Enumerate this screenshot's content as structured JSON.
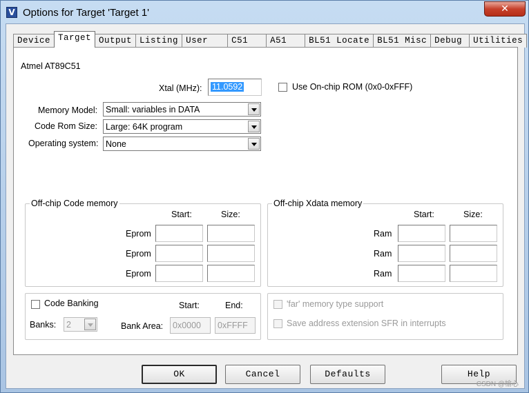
{
  "window": {
    "title": "Options for Target 'Target 1'",
    "icon_letter": "V",
    "close_glyph": "✕"
  },
  "tabs": [
    {
      "label": "Device"
    },
    {
      "label": "Target"
    },
    {
      "label": "Output"
    },
    {
      "label": "Listing"
    },
    {
      "label": "User"
    },
    {
      "label": "C51"
    },
    {
      "label": "A51"
    },
    {
      "label": "BL51 Locate"
    },
    {
      "label": "BL51 Misc"
    },
    {
      "label": "Debug"
    },
    {
      "label": "Utilities"
    }
  ],
  "target": {
    "device_name": "Atmel AT89C51",
    "xtal_label": "Xtal (MHz):",
    "xtal_value": "11.0592",
    "onchip_rom_label": "Use On-chip ROM (0x0-0xFFF)",
    "memory_model_label": "Memory Model:",
    "memory_model_value": "Small: variables in DATA",
    "code_rom_label": "Code Rom Size:",
    "code_rom_value": "Large: 64K program",
    "os_label": "Operating system:",
    "os_value": "None"
  },
  "code_memory": {
    "title": "Off-chip Code memory",
    "start_header": "Start:",
    "size_header": "Size:",
    "rows": [
      {
        "label": "Eprom"
      },
      {
        "label": "Eprom"
      },
      {
        "label": "Eprom"
      }
    ]
  },
  "xdata_memory": {
    "title": "Off-chip Xdata memory",
    "start_header": "Start:",
    "size_header": "Size:",
    "rows": [
      {
        "label": "Ram"
      },
      {
        "label": "Ram"
      },
      {
        "label": "Ram"
      }
    ]
  },
  "banking": {
    "code_banking_label": "Code Banking",
    "start_header": "Start:",
    "end_header": "End:",
    "banks_label": "Banks:",
    "banks_value": "2",
    "bank_area_label": "Bank Area:",
    "bank_area_start": "0x0000",
    "bank_area_end": "0xFFFF"
  },
  "options": {
    "far_memory_label": "'far' memory type support",
    "save_sfr_label": "Save address extension SFR in interrupts"
  },
  "buttons": {
    "ok": "OK",
    "cancel": "Cancel",
    "defaults": "Defaults",
    "help": "Help"
  },
  "watermark": "CSDN @榆心"
}
